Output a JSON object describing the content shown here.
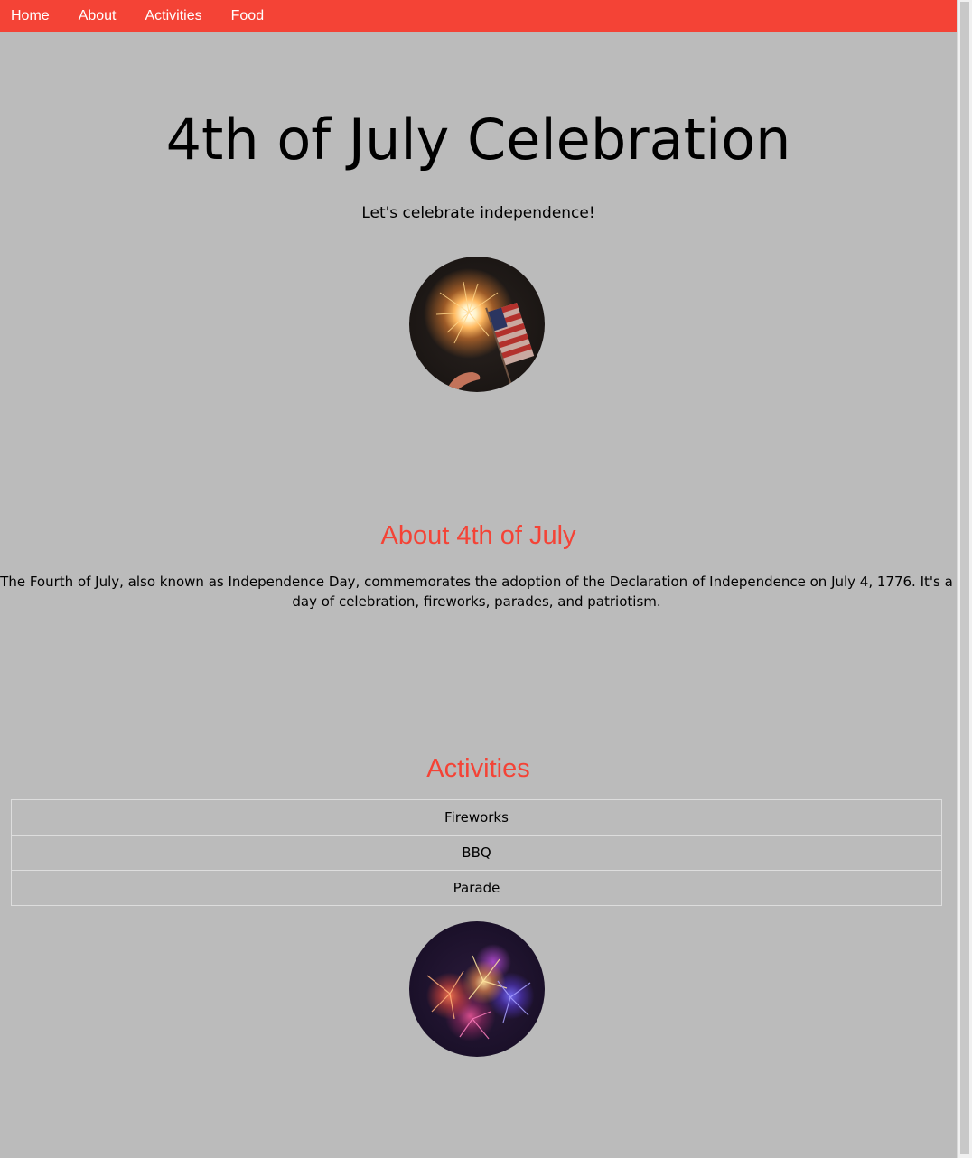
{
  "nav": {
    "items": [
      {
        "label": "Home"
      },
      {
        "label": "About"
      },
      {
        "label": "Activities"
      },
      {
        "label": "Food"
      }
    ]
  },
  "hero": {
    "title": "4th of July Celebration",
    "subtitle": "Let's celebrate independence!",
    "image_icon": "sparkler-flag-photo"
  },
  "about": {
    "heading": "About 4th of July",
    "text": "The Fourth of July, also known as Independence Day, commemorates the adoption of the Declaration of Independence on July 4, 1776. It's a day of celebration, fireworks, parades, and patriotism."
  },
  "activities": {
    "heading": "Activities",
    "items": [
      {
        "label": "Fireworks"
      },
      {
        "label": "BBQ"
      },
      {
        "label": "Parade"
      }
    ],
    "image_icon": "fireworks-photo"
  },
  "colors": {
    "accent": "#f44336",
    "background": "#bbbbbb",
    "nav_text": "#ffffff"
  }
}
